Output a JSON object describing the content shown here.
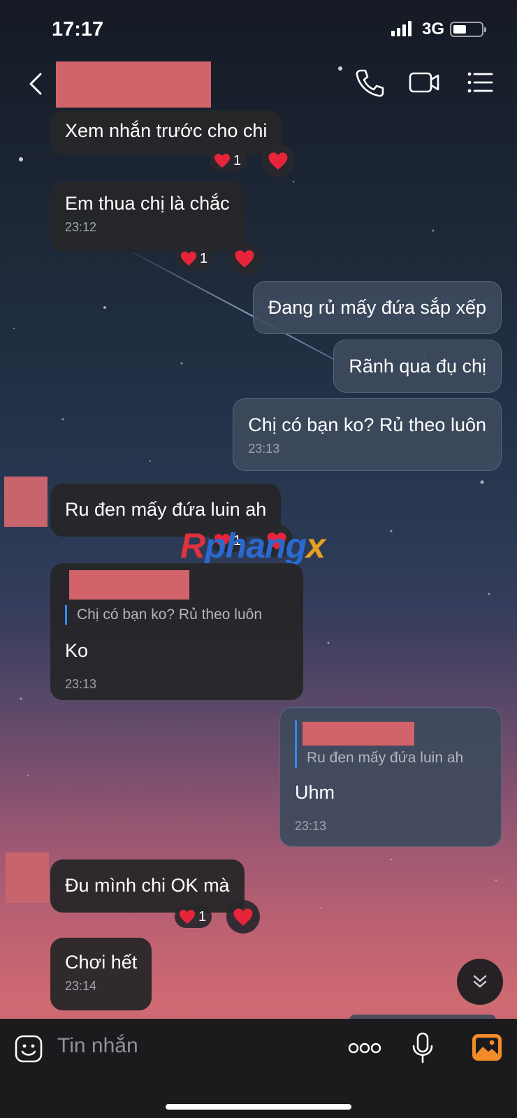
{
  "status_bar": {
    "time": "17:17",
    "network": "3G",
    "battery_level": 0.45
  },
  "header": {
    "back_icon": "chevron-left-icon",
    "call_icon": "phone-icon",
    "video_icon": "video-camera-icon",
    "menu_icon": "list-menu-icon"
  },
  "messages": [
    {
      "side": "in",
      "text": "Xem nhắn trước cho chi",
      "reaction_count": "1"
    },
    {
      "side": "in",
      "text": "Em thua chị là chắc",
      "time": "23:12",
      "reaction_count": "1"
    },
    {
      "side": "out",
      "text": "Đang rủ mấy đứa sắp xếp"
    },
    {
      "side": "out",
      "text": "Rãnh qua đụ chị"
    },
    {
      "side": "out",
      "text": "Chị có bạn ko? Rủ theo luôn",
      "time": "23:13"
    },
    {
      "side": "in",
      "text": "Ru đen mấy đứa luin ah",
      "reaction_count": "1"
    },
    {
      "side": "in",
      "quote": "Chị có bạn ko? Rủ theo luôn",
      "text": "Ko",
      "time": "23:13"
    },
    {
      "side": "out",
      "quote": "Ru đen mấy đứa luin ah",
      "text": "Uhm",
      "time": "23:13"
    },
    {
      "side": "in",
      "text": "Đu mình chi OK mà",
      "reaction_count": "1"
    },
    {
      "side": "in",
      "text": "Chơi hết",
      "time": "23:14"
    }
  ],
  "watermark": {
    "part1": "R",
    "part2": "phang",
    "part3": "x"
  },
  "composer": {
    "placeholder": "Tin nhắn",
    "sticker_icon": "emoji-sticker-icon",
    "more_icon": "more-dots-icon",
    "mic_icon": "microphone-icon",
    "gallery_icon": "image-gallery-icon"
  },
  "colors": {
    "heart": "#e8243a",
    "reply_accent": "#2f8df0",
    "gallery_icon": "#f28c28",
    "redaction": "#d2636a"
  }
}
